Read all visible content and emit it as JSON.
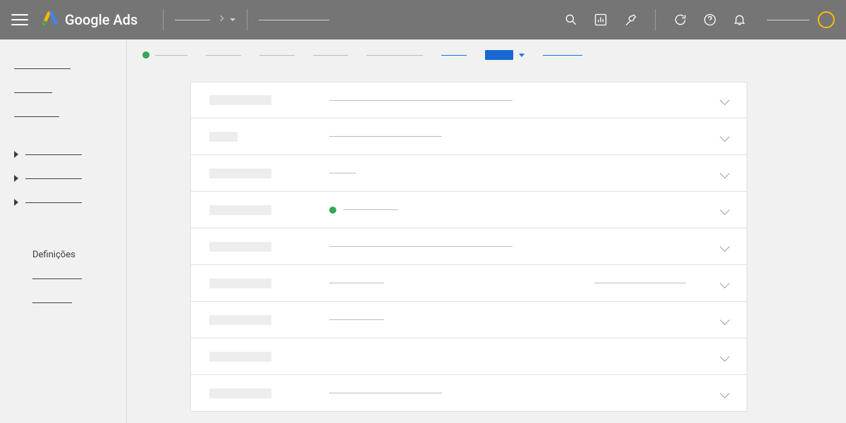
{
  "header": {
    "product_name": "Google Ads"
  },
  "sidebar": {
    "settings_label": "Definições"
  },
  "rows": [
    {
      "label_w": "w88",
      "lines": [
        "w260"
      ],
      "dot": false,
      "extra": null
    },
    {
      "label_w": "w40",
      "lines": [
        "w160"
      ],
      "dot": false,
      "extra": null
    },
    {
      "label_w": "w88",
      "lines": [
        "w38"
      ],
      "dot": false,
      "extra": null
    },
    {
      "label_w": "w88",
      "lines": [
        "w78"
      ],
      "dot": true,
      "extra": null
    },
    {
      "label_w": "w88",
      "lines": [
        "w260"
      ],
      "dot": false,
      "extra": null
    },
    {
      "label_w": "w88",
      "lines": [
        "w78"
      ],
      "dot": false,
      "extra": "w130"
    },
    {
      "label_w": "w88",
      "lines": [
        "w78"
      ],
      "dot": false,
      "extra": null
    },
    {
      "label_w": "w88",
      "lines": [],
      "dot": false,
      "extra": null
    },
    {
      "label_w": "w88",
      "lines": [
        "w160"
      ],
      "dot": false,
      "extra": null
    }
  ],
  "colors": {
    "accent_blue": "#1a73e8",
    "green": "#34a853",
    "amber": "#fbbc04"
  }
}
